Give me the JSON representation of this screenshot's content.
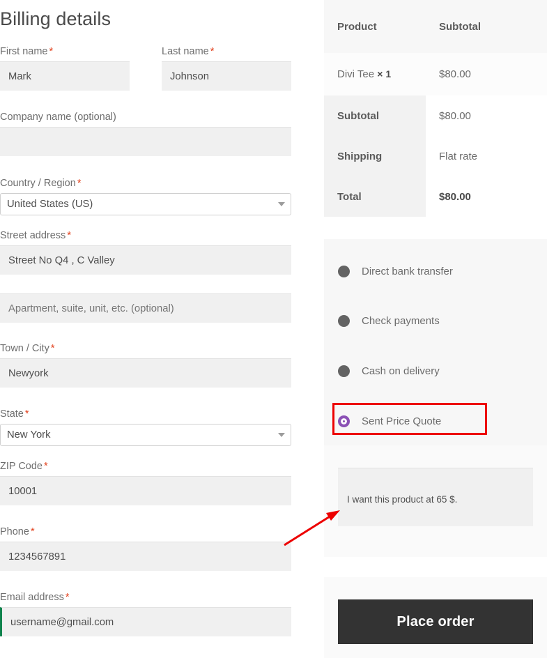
{
  "billing": {
    "title": "Billing details",
    "required_mark": "*",
    "fields": [
      {
        "label": "First name",
        "required": true,
        "value": "Mark",
        "placeholder": ""
      },
      {
        "label": "Last name",
        "required": true,
        "value": "Johnson",
        "placeholder": ""
      },
      {
        "label": "Company name (optional)",
        "required": false,
        "value": "",
        "placeholder": ""
      },
      {
        "label": "Country / Region",
        "required": true,
        "value": "United States (US)",
        "placeholder": ""
      },
      {
        "label": "Street address",
        "required": true,
        "value": "Street No Q4 , C Valley",
        "placeholder": ""
      },
      {
        "label": "",
        "required": false,
        "value": "",
        "placeholder": "Apartment, suite, unit, etc. (optional)"
      },
      {
        "label": "Town / City",
        "required": true,
        "value": "Newyork",
        "placeholder": ""
      },
      {
        "label": "State",
        "required": true,
        "value": "New York",
        "placeholder": ""
      },
      {
        "label": "ZIP Code",
        "required": true,
        "value": "10001",
        "placeholder": ""
      },
      {
        "label": "Phone",
        "required": true,
        "value": "1234567891",
        "placeholder": ""
      },
      {
        "label": "Email address",
        "required": true,
        "value": "username@gmail.com",
        "placeholder": ""
      }
    ]
  },
  "order_review": {
    "headers": {
      "product": "Product",
      "subtotal": "Subtotal"
    },
    "items": [
      {
        "name": "Divi Tee",
        "qty": "× 1",
        "price": "$80.00"
      }
    ],
    "totals": [
      {
        "label": "Subtotal",
        "value": "$80.00"
      },
      {
        "label": "Shipping",
        "value": "Flat rate"
      },
      {
        "label": "Total",
        "value": "$80.00"
      }
    ]
  },
  "payment": {
    "methods": [
      {
        "label": "Direct bank transfer",
        "selected": false
      },
      {
        "label": "Check payments",
        "selected": false
      },
      {
        "label": "Cash on delivery",
        "selected": false
      },
      {
        "label": "Sent Price Quote",
        "selected": true
      }
    ],
    "selected_accent": "#8b51b5",
    "note": {
      "value": "I want this product at 65 $.",
      "placeholder": ""
    }
  },
  "actions": {
    "place_order_label": "Place order"
  },
  "annotation": {
    "color": "#ed0000"
  }
}
